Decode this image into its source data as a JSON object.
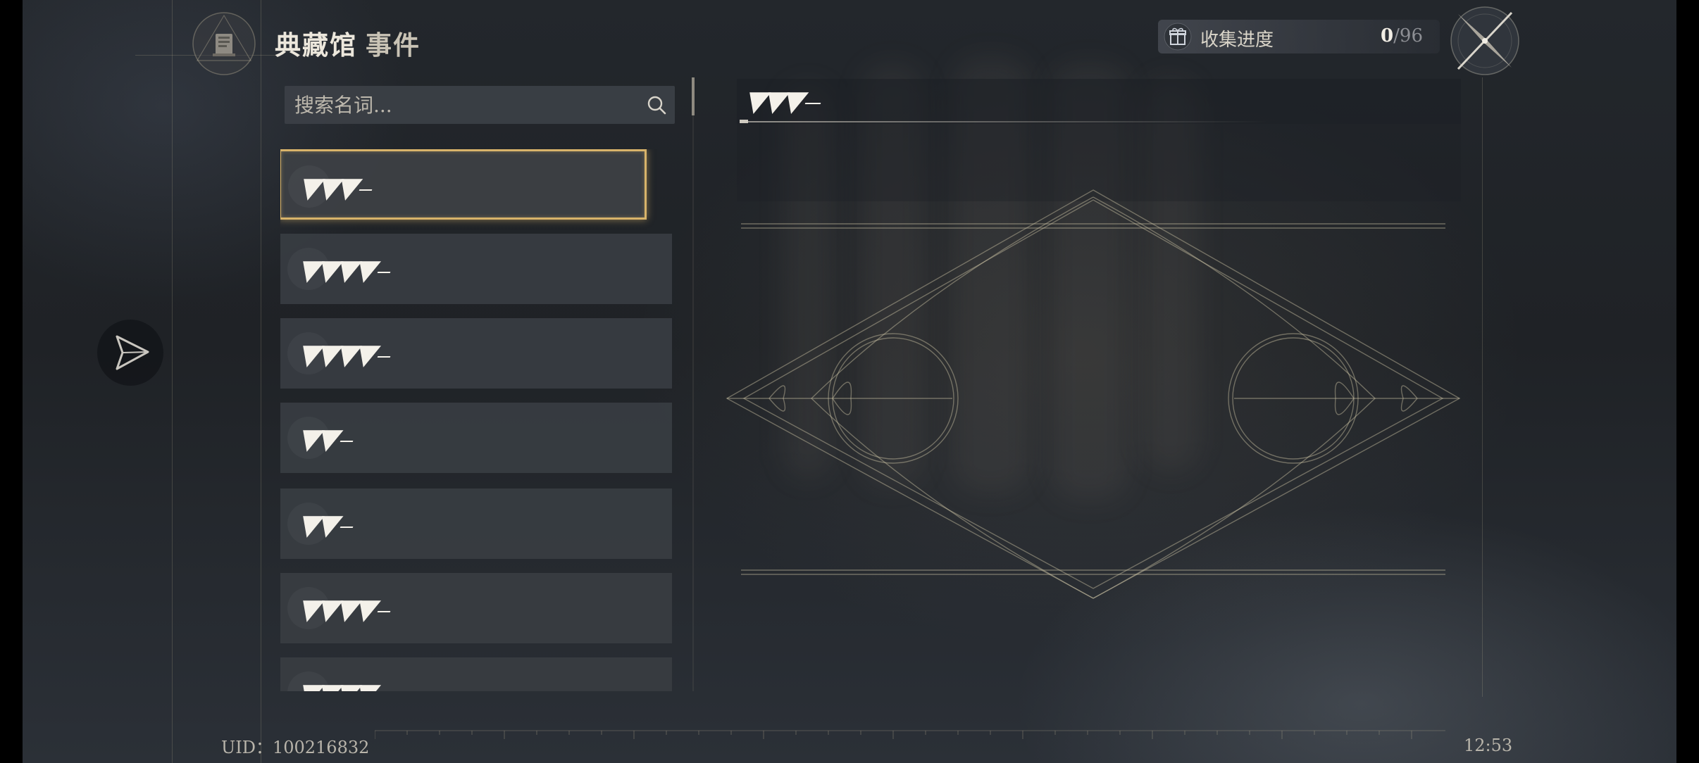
{
  "header": {
    "title": "典藏馆",
    "subtitle": "事件",
    "progress": {
      "label": "收集进度",
      "current": "0",
      "separator": "/",
      "total": "96"
    }
  },
  "search": {
    "placeholder": "搜索名词..."
  },
  "list": {
    "items": [
      {
        "label": "▼▼▼",
        "selected": true
      },
      {
        "label": "▼▼▼▼",
        "selected": false
      },
      {
        "label": "▼▼▼▼",
        "selected": false
      },
      {
        "label": "▼▼",
        "selected": false
      },
      {
        "label": "▼▼",
        "selected": false
      },
      {
        "label": "▼▼▼▼",
        "selected": false
      },
      {
        "label": "▼▼▼▼",
        "selected": false
      }
    ]
  },
  "detail": {
    "title": "▼▼▼"
  },
  "footer": {
    "uid": "UID：100216832",
    "time": "12:53"
  },
  "icons": {
    "emblem": "codex-emblem-icon",
    "progress": "gift-box-icon",
    "compass": "compass-icon",
    "side": "paper-plane-icon",
    "search": "search-icon"
  },
  "colors": {
    "accent": "#d8b36a",
    "panel": "#383c41",
    "text": "#f4f1ea"
  }
}
